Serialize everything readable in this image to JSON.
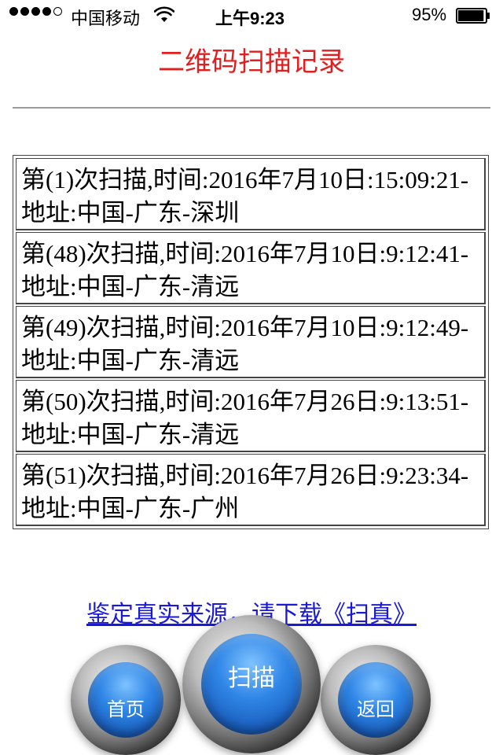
{
  "status_bar": {
    "signal_dots": [
      true,
      true,
      true,
      true,
      false
    ],
    "carrier": "中国移动",
    "time": "上午9:23",
    "battery_percent": "95%",
    "battery_level": 0.95
  },
  "page": {
    "title": "二维码扫描记录",
    "title_color": "#e02020"
  },
  "records": [
    {
      "line1": "第(1)次扫描,时间:2016年7月10日:15:09:21-",
      "line2": "地址:中国-广东-深圳"
    },
    {
      "line1": "第(48)次扫描,时间:2016年7月10日:9:12:41-",
      "line2": "地址:中国-广东-清远"
    },
    {
      "line1": "第(49)次扫描,时间:2016年7月10日:9:12:49-",
      "line2": "地址:中国-广东-清远"
    },
    {
      "line1": "第(50)次扫描,时间:2016年7月26日:9:13:51-",
      "line2": "地址:中国-广东-清远"
    },
    {
      "line1": "第(51)次扫描,时间:2016年7月26日:9:23:34-",
      "line2": "地址:中国-广东-广州"
    }
  ],
  "link": {
    "text": "鉴定真实来源，请下载《扫真》",
    "color": "#1a1ad6"
  },
  "buttons": {
    "home": "首页",
    "scan": "扫描",
    "back": "返回"
  }
}
